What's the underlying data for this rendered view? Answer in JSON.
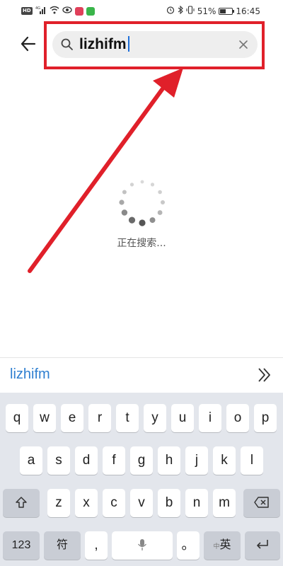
{
  "status_bar": {
    "network_badge": "HD",
    "signal_label": "4G",
    "battery_percent_text": "51%",
    "battery_level": 0.51,
    "time": "16:45"
  },
  "search": {
    "back_icon": "arrow-left-icon",
    "value": "lizhifm",
    "search_icon": "magnifier-icon",
    "clear_icon": "close-icon"
  },
  "loading": {
    "text": "正在搜索..."
  },
  "suggestion": {
    "word": "lizhifm",
    "expand_icon": "double-chevron-right-icon"
  },
  "keyboard": {
    "row1": [
      "q",
      "w",
      "e",
      "r",
      "t",
      "y",
      "u",
      "i",
      "o",
      "p"
    ],
    "row2": [
      "a",
      "s",
      "d",
      "f",
      "g",
      "h",
      "j",
      "k",
      "l"
    ],
    "row3": [
      "z",
      "x",
      "c",
      "v",
      "b",
      "n",
      "m"
    ],
    "shift_icon": "shift-up-arrow-icon",
    "delete_icon": "backspace-icon",
    "numbers_key": "123",
    "symbols_key": "符",
    "comma_key": ",",
    "period_key": "。",
    "lang_key_small": "中",
    "lang_key": "英",
    "enter_icon": "enter-icon"
  },
  "colors": {
    "highlight_red": "#e0202a",
    "accent_blue": "#2f7fd0",
    "keyboard_bg": "#e3e6ec"
  }
}
